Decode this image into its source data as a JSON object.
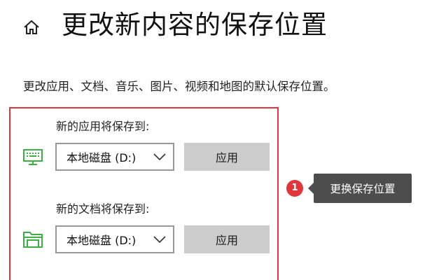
{
  "header": {
    "home_icon": "home-icon",
    "title": "更改新内容的保存位置"
  },
  "description": "更改应用、文档、音乐、图片、视频和地图的默认保存位置。",
  "settings": [
    {
      "label": "新的应用将保存到:",
      "icon": "monitor-icon",
      "selected_drive": "本地磁盘 (D:)",
      "apply_label": "应用"
    },
    {
      "label": "新的文档将保存到:",
      "icon": "folder-icon",
      "selected_drive": "本地磁盘 (D:)",
      "apply_label": "应用"
    }
  ],
  "annotation": {
    "step_number": "1",
    "callout_text": "更换保存位置"
  },
  "colors": {
    "highlight_red": "#e0373c",
    "icon_green": "#3cb043",
    "button_gray": "#cccccc",
    "callout_bg": "#4d4d4d"
  }
}
